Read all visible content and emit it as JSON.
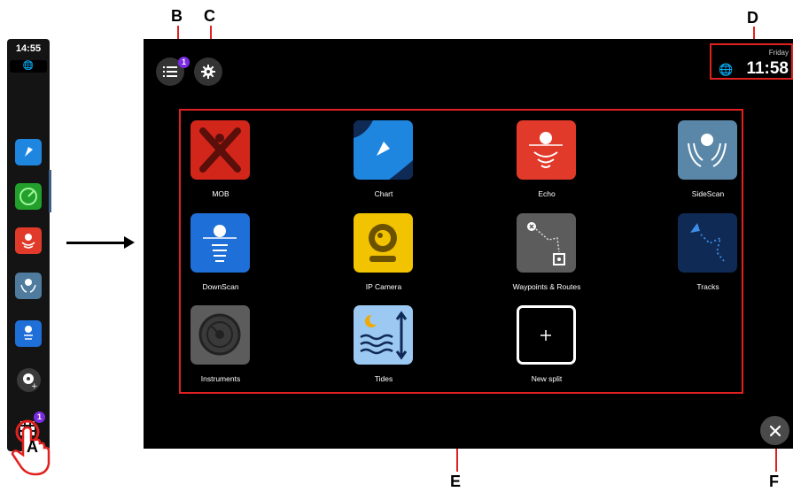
{
  "callouts": {
    "a": "A",
    "b": "B",
    "c": "C",
    "d": "D",
    "e": "E",
    "f": "F"
  },
  "sidebar": {
    "time": "14:55",
    "apps_badge": "1",
    "items": [
      {
        "name": "chart",
        "color": "#1f86e0"
      },
      {
        "name": "radar",
        "color": "#22a02b"
      },
      {
        "name": "echo",
        "color": "#e13a2a"
      },
      {
        "name": "sidescan",
        "color": "#4f7c9e"
      },
      {
        "name": "downscan",
        "color": "#1f6fd8"
      }
    ]
  },
  "header": {
    "notifications_badge": "1",
    "day": "Friday",
    "time": "11:58"
  },
  "apps": [
    {
      "label": "MOB",
      "color": "#d3261b",
      "icon": "mob-icon"
    },
    {
      "label": "Chart",
      "color": "#1f86e0",
      "icon": "chart-icon"
    },
    {
      "label": "Echo",
      "color": "#e13a2a",
      "icon": "echo-icon"
    },
    {
      "label": "SideScan",
      "color": "#5a87a8",
      "icon": "sidescan-icon"
    },
    {
      "label": "DownScan",
      "color": "#1f6fd8",
      "icon": "downscan-icon"
    },
    {
      "label": "IP Camera",
      "color": "#f2c300",
      "icon": "camera-icon"
    },
    {
      "label": "Waypoints & Routes",
      "color": "#5c5c5c",
      "icon": "waypoints-icon"
    },
    {
      "label": "Tracks",
      "color": "#0f2a55",
      "icon": "tracks-icon"
    },
    {
      "label": "Instruments",
      "color": "#5c5c5c",
      "icon": "instruments-icon"
    },
    {
      "label": "Tides",
      "color": "#9cc9f2",
      "icon": "tides-icon"
    },
    {
      "label": "New split",
      "color": "#000000",
      "icon": "plus-icon"
    }
  ],
  "colors": {
    "accent": "#e0211f",
    "badge": "#7a2be2"
  }
}
